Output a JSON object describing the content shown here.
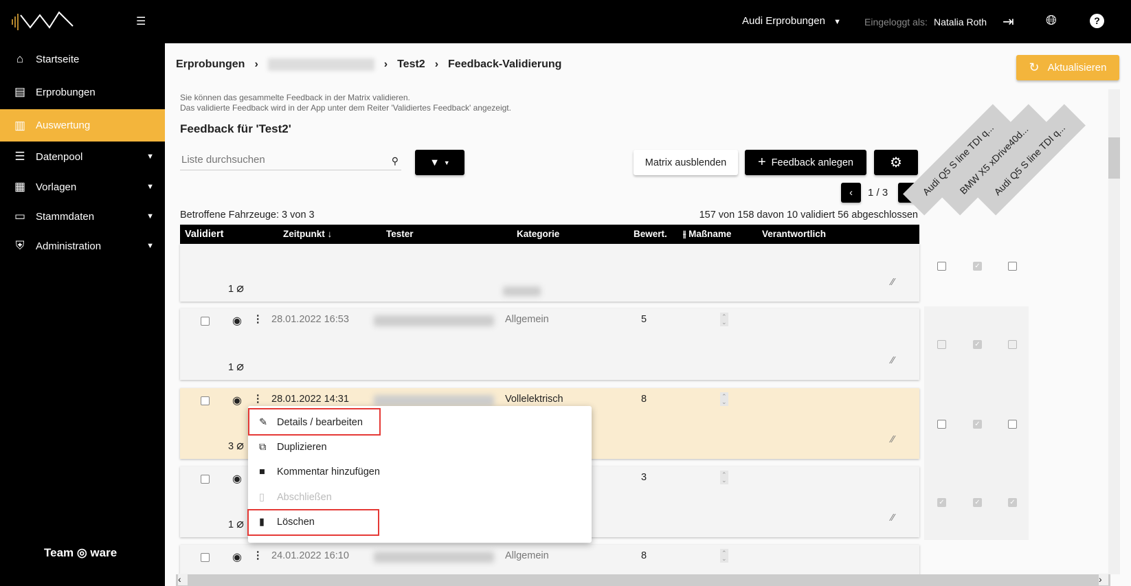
{
  "sidebar": {
    "items": [
      {
        "label": "Startseite",
        "icon": "home-icon"
      },
      {
        "label": "Erprobungen",
        "icon": "clipboard-icon"
      },
      {
        "label": "Auswertung",
        "icon": "chart-icon",
        "active": true
      },
      {
        "label": "Datenpool",
        "icon": "database-icon",
        "expandable": true
      },
      {
        "label": "Vorlagen",
        "icon": "layout-icon",
        "expandable": true
      },
      {
        "label": "Stammdaten",
        "icon": "inbox-icon",
        "expandable": true
      },
      {
        "label": "Administration",
        "icon": "shield-icon",
        "expandable": true
      }
    ],
    "footer_logo": "Team ware SOLUTIONS"
  },
  "topbar": {
    "project": "Audi Erprobungen",
    "logged_in_label": "Eingeloggt als:",
    "user": "Natalia Roth"
  },
  "breadcrumb": [
    "Erprobungen",
    "Test2",
    "Feedback-Validierung"
  ],
  "refresh_label": "Aktualisieren",
  "info": {
    "line1": "Sie können das gesammelte Feedback in der Matrix validieren.",
    "line2": "Das validierte Feedback wird in der App unter dem Reiter 'Validiertes Feedback' angezeigt."
  },
  "title": "Feedback für 'Test2'",
  "search": {
    "placeholder": "Liste durchsuchen"
  },
  "buttons": {
    "hide_matrix": "Matrix ausblenden",
    "add_feedback": "Feedback anlegen"
  },
  "pagination": "1 / 3",
  "vehicles_count": "Betroffene Fahrzeuge: 3 von 3",
  "summary": "157 von 158 davon 10 validiert 56 abgeschlossen",
  "columns": [
    "Validiert",
    "Zeitpunkt",
    "Tester",
    "Kategorie",
    "Bewert.",
    "Maßname",
    "Verantwortlich"
  ],
  "vehicles": [
    "Audi Q5 S line TDI q...",
    "BMW X5 xDrive40d...",
    "Audi Q5 S line TDI q..."
  ],
  "rows": [
    {
      "attachments": "1",
      "date": "",
      "category": "",
      "rating": "",
      "matrix": [
        "empty",
        "checked",
        "empty"
      ]
    },
    {
      "attachments": "1",
      "date": "28.01.2022 16:53",
      "category": "Allgemein",
      "rating": "5",
      "matrix": [
        "disabled",
        "checked",
        "disabled"
      ]
    },
    {
      "attachments": "3",
      "date": "28.01.2022 14:31",
      "category": "Vollelektrisch",
      "rating": "8",
      "matrix": [
        "empty",
        "checked",
        "empty"
      ],
      "selected": true
    },
    {
      "attachments": "1",
      "date": "",
      "category": "",
      "rating": "3",
      "matrix": [
        "checked",
        "checked",
        "checked"
      ]
    },
    {
      "attachments": "",
      "date": "24.01.2022 16:10",
      "category": "Allgemein",
      "rating": "8",
      "matrix": []
    }
  ],
  "context_menu": [
    {
      "label": "Details / bearbeiten",
      "icon": "pencil-icon"
    },
    {
      "label": "Duplizieren",
      "icon": "duplicate-icon"
    },
    {
      "label": "Kommentar hinzufügen",
      "icon": "comment-icon"
    },
    {
      "label": "Abschließen",
      "icon": "document-icon",
      "disabled": true
    },
    {
      "label": "Löschen",
      "icon": "trash-icon"
    }
  ],
  "colors": {
    "accent": "#f3b53c",
    "highlight": "#e53935",
    "selected_row": "#faecd0"
  }
}
